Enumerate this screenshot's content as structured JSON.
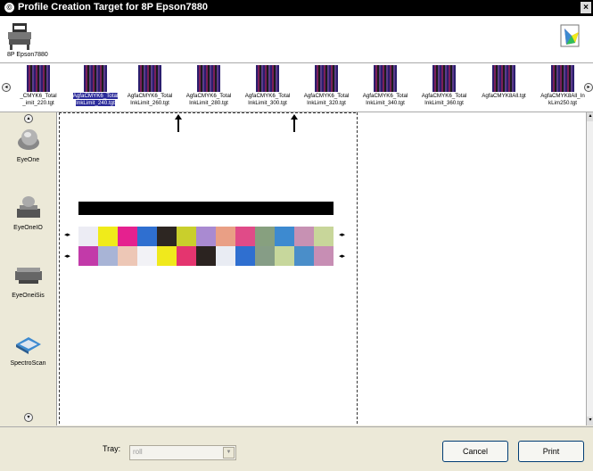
{
  "window": {
    "title": "Profile Creation Target for 8P Epson7880"
  },
  "printer": {
    "label": "8P Epson7880"
  },
  "thumbnails": [
    {
      "label_1": "_CMYK6_Total",
      "label_2": "_imit_220.tgt",
      "selected": false
    },
    {
      "label_1": "AgfaCMYK6_Total",
      "label_2": "InkLimit_240.tgt",
      "selected": true
    },
    {
      "label_1": "AgfaCMYK6_Total",
      "label_2": "InkLimit_260.tgt",
      "selected": false
    },
    {
      "label_1": "AgfaCMYK6_Total",
      "label_2": "InkLimit_280.tgt",
      "selected": false
    },
    {
      "label_1": "AgfaCMYK6_Total",
      "label_2": "InkLimit_300.tgt",
      "selected": false
    },
    {
      "label_1": "AgfaCMYK6_Total",
      "label_2": "InkLimit_320.tgt",
      "selected": false
    },
    {
      "label_1": "AgfaCMYK6_Total",
      "label_2": "InkLimit_340.tgt",
      "selected": false
    },
    {
      "label_1": "AgfaCMYK6_Total",
      "label_2": "InkLimit_360.tgt",
      "selected": false
    },
    {
      "label_1": "AgfaCMYK8All.tgt",
      "label_2": "",
      "selected": false
    },
    {
      "label_1": "AgfaCMYK8All_In",
      "label_2": "kLim250.tgt",
      "selected": false
    }
  ],
  "devices": [
    {
      "label": "EyeOne",
      "selected": false
    },
    {
      "label": "EyeOneIO",
      "selected": false
    },
    {
      "label": "EyeOneiSis",
      "selected": true
    },
    {
      "label": "SpectroScan",
      "selected": false
    }
  ],
  "patches": {
    "row1": [
      "#ececf4",
      "#f0eb1a",
      "#e5218f",
      "#2f6fd0",
      "#2d2622",
      "#c9cf2c",
      "#a98ad1",
      "#e99f85",
      "#e04b88",
      "#87a07f",
      "#3d8ad0",
      "#c791b3",
      "#c8d69a"
    ],
    "row2": [
      "#c23aa9",
      "#a8b4d6",
      "#edc7b6",
      "#f2f2f6",
      "#f0e91c",
      "#e4356f",
      "#2b2320",
      "#e9ecf3",
      "#2f6fd0",
      "#869d86",
      "#c7d79c",
      "#4a8ec9",
      "#c78eb4"
    ]
  },
  "footer": {
    "tray_label": "Tray:",
    "tray_value": "roll",
    "cancel_label": "Cancel",
    "print_label": "Print"
  }
}
